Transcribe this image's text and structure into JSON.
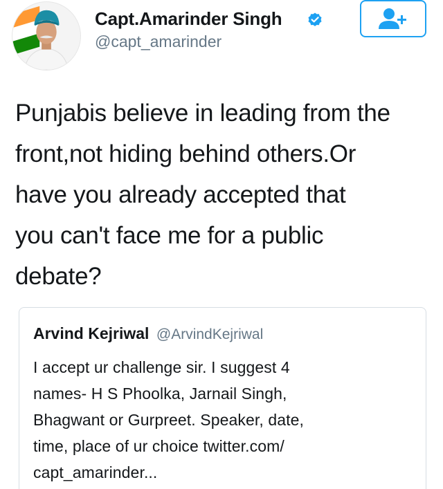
{
  "author": {
    "display_name": "Capt.Amarinder Singh",
    "handle": "@capt_amarinder",
    "avatar_icon": "profile-photo",
    "verified_icon": "verified-badge-icon"
  },
  "follow_button": {
    "icon": "add-user-icon",
    "accent_color": "#1da1f2"
  },
  "tweet": {
    "lines": [
      "Punjabis believe in leading from the",
      "front,not hiding behind others.Or",
      "have you already accepted that",
      "you can't face me for a public",
      "debate?"
    ]
  },
  "quoted_tweet": {
    "display_name": "Arvind Kejriwal",
    "handle": "@ArvindKejriwal",
    "lines": [
      "I accept ur challenge sir. I suggest 4",
      "names- H S Phoolka, Jarnail Singh,",
      "Bhagwant or Gurpreet. Speaker, date,",
      "time, place of ur choice twitter.com/",
      "capt_amarinder..."
    ]
  },
  "colors": {
    "text_primary": "#14171a",
    "text_secondary": "#657786",
    "accent": "#1da1f2",
    "card_border": "#d6dde3"
  }
}
